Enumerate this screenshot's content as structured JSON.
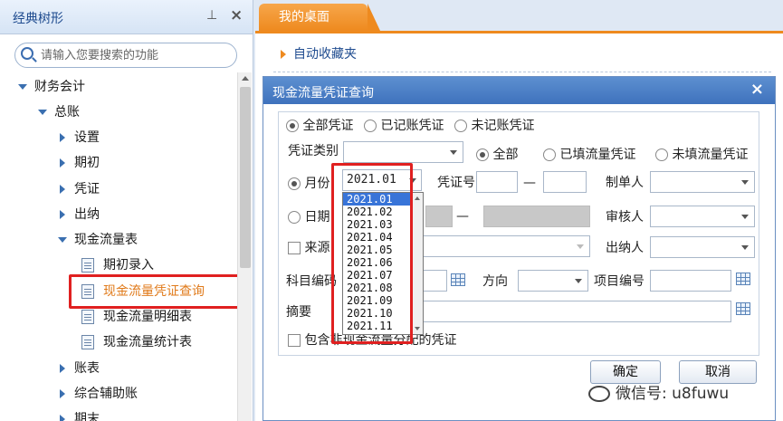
{
  "left_panel": {
    "title": "经典树形",
    "search_placeholder": "请输入您要搜索的功能",
    "tree": [
      {
        "label": "财务会计",
        "level": 0,
        "state": "expanded"
      },
      {
        "label": "总账",
        "level": 1,
        "state": "expanded"
      },
      {
        "label": "设置",
        "level": 2,
        "state": "collapsed"
      },
      {
        "label": "期初",
        "level": 2,
        "state": "collapsed"
      },
      {
        "label": "凭证",
        "level": 2,
        "state": "collapsed"
      },
      {
        "label": "出纳",
        "level": 2,
        "state": "collapsed"
      },
      {
        "label": "现金流量表",
        "level": 2,
        "state": "expanded"
      },
      {
        "label": "期初录入",
        "level": 3,
        "state": "leaf"
      },
      {
        "label": "现金流量凭证查询",
        "level": 3,
        "state": "leaf",
        "selected": true
      },
      {
        "label": "现金流量明细表",
        "level": 3,
        "state": "leaf"
      },
      {
        "label": "现金流量统计表",
        "level": 3,
        "state": "leaf"
      },
      {
        "label": "账表",
        "level": 2,
        "state": "collapsed"
      },
      {
        "label": "综合辅助账",
        "level": 2,
        "state": "collapsed"
      },
      {
        "label": "期末",
        "level": 2,
        "state": "collapsed"
      }
    ]
  },
  "tabs": {
    "desk": "我的桌面"
  },
  "desk": {
    "favorites": "自动收藏夹"
  },
  "dialog": {
    "title": "现金流量凭证查询",
    "close": "×",
    "voucher_scope": {
      "all": "全部凭证",
      "posted": "已记账凭证",
      "unposted": "未记账凭证"
    },
    "voucher_type_label": "凭证类别",
    "flow_filter": {
      "all": "全部",
      "filled": "已填流量凭证",
      "unfilled": "未填流量凭证"
    },
    "month_label": "月份",
    "month_value": "2021.01",
    "month_options": [
      "2021.01",
      "2021.02",
      "2021.03",
      "2021.04",
      "2021.05",
      "2021.06",
      "2021.07",
      "2021.08",
      "2021.09",
      "2021.10",
      "2021.11"
    ],
    "voucher_no_label": "凭证号",
    "dash": "—",
    "maker_label": "制单人",
    "date_label": "日期",
    "reviewer_label": "审核人",
    "source_label": "来源",
    "cashier_label": "出纳人",
    "account_code_label": "科目编码",
    "direction_label": "方向",
    "project_code_label": "项目编号",
    "summary_label": "摘要",
    "include_label": "包含非现金流量分配的凭证",
    "ok": "确定",
    "cancel": "取消"
  },
  "watermark": "微信号: u8fuwu"
}
